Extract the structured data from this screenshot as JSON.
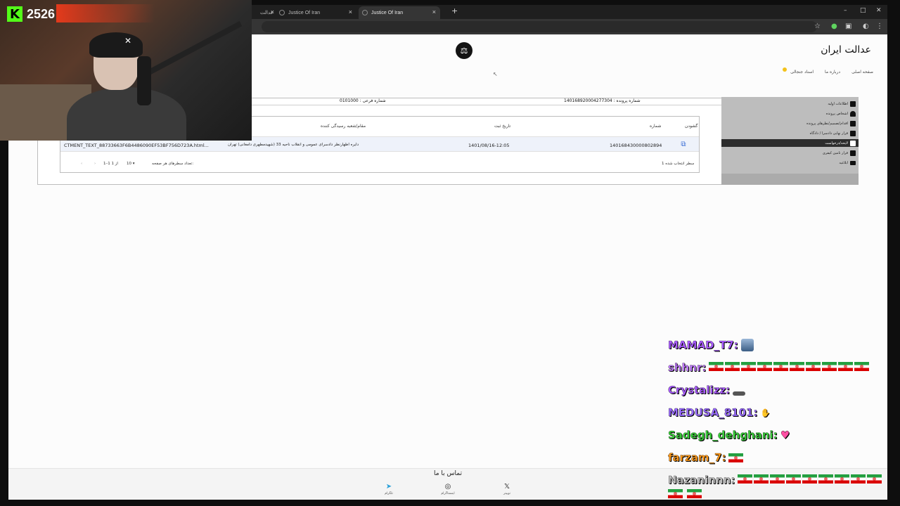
{
  "stream": {
    "viewer_count": "2526",
    "platform_logo": "K"
  },
  "browser": {
    "tabs": [
      {
        "label": "عدالت",
        "active": false
      },
      {
        "label": "Justice Of Iran",
        "active": false
      },
      {
        "label": "Justice Of Iran",
        "active": true
      }
    ],
    "new_tab_label": "+"
  },
  "site": {
    "title": "عدالت ایران",
    "nav": [
      "صفحه اصلی",
      "درباره ما",
      "اسناد جنجالی"
    ]
  },
  "sidebar": {
    "items": [
      {
        "label": "اطلاعات اولیه",
        "active": false
      },
      {
        "label": "اشخاص پرونده",
        "active": false
      },
      {
        "label": "اقدام/تصمیم/نظرهای پرونده",
        "active": false
      },
      {
        "label": "قرار نهایی دادسرا / دادگاه",
        "active": false
      },
      {
        "label": "لایحه/درخواست",
        "active": true
      },
      {
        "label": "قرار تامین کیفری",
        "active": false
      },
      {
        "label": "ابلاغیه",
        "active": false
      }
    ]
  },
  "case": {
    "case_number": "شماره پرونده : 140168920004277304",
    "sub_number": "شماره فرعی : 0101000"
  },
  "table": {
    "headers": {
      "actions": "گشودن",
      "number": "شماره",
      "date": "تاریخ ثبت",
      "office": "مقام/شعبه رسیدگی کننده"
    },
    "row": {
      "number": "140168430000802894",
      "date": "1401/08/16-12:05",
      "office": "دایره اظهارنظر دادسرای عمومی و انقلاب ناحیه 33 (شهیدمطهری دامغانی) تهران",
      "file": "CTMENT_TEXT_88733663F6B4486090EF53BF756D723A.html..."
    },
    "footer": {
      "selected": "1 سطر انتخاب شده",
      "rows_per_page_label": "تعداد سطرهای هر صفحه:",
      "rows_per_page_value": "10",
      "range": "1–1 از 1"
    }
  },
  "contact": {
    "title": "تماس با ما",
    "links": [
      {
        "label": "توییتر",
        "icon": "x-icon"
      },
      {
        "label": "اینستاگرام",
        "icon": "instagram-icon"
      },
      {
        "label": "تلگرام",
        "icon": "telegram-icon"
      }
    ]
  },
  "chat": [
    {
      "user": "MAMAD_T7:",
      "color": "#a95bff"
    },
    {
      "user": "shhnr:",
      "color": "#c27cff"
    },
    {
      "user": "Crystalizz:",
      "color": "#a95bff"
    },
    {
      "user": "MEDUSA_8101:",
      "color": "#9a6bff"
    },
    {
      "user": "Sadegh_dehghani:",
      "color": "#3ad13a"
    },
    {
      "user": "farzam_7:",
      "color": "#ff9a1a"
    },
    {
      "user": "Nazaninnn:",
      "color": "#bfbfbf"
    }
  ],
  "colors": {
    "accent": "#3b6fd6",
    "kick_green": "#53fc18",
    "sidebar_active": "#2d2d2d"
  }
}
